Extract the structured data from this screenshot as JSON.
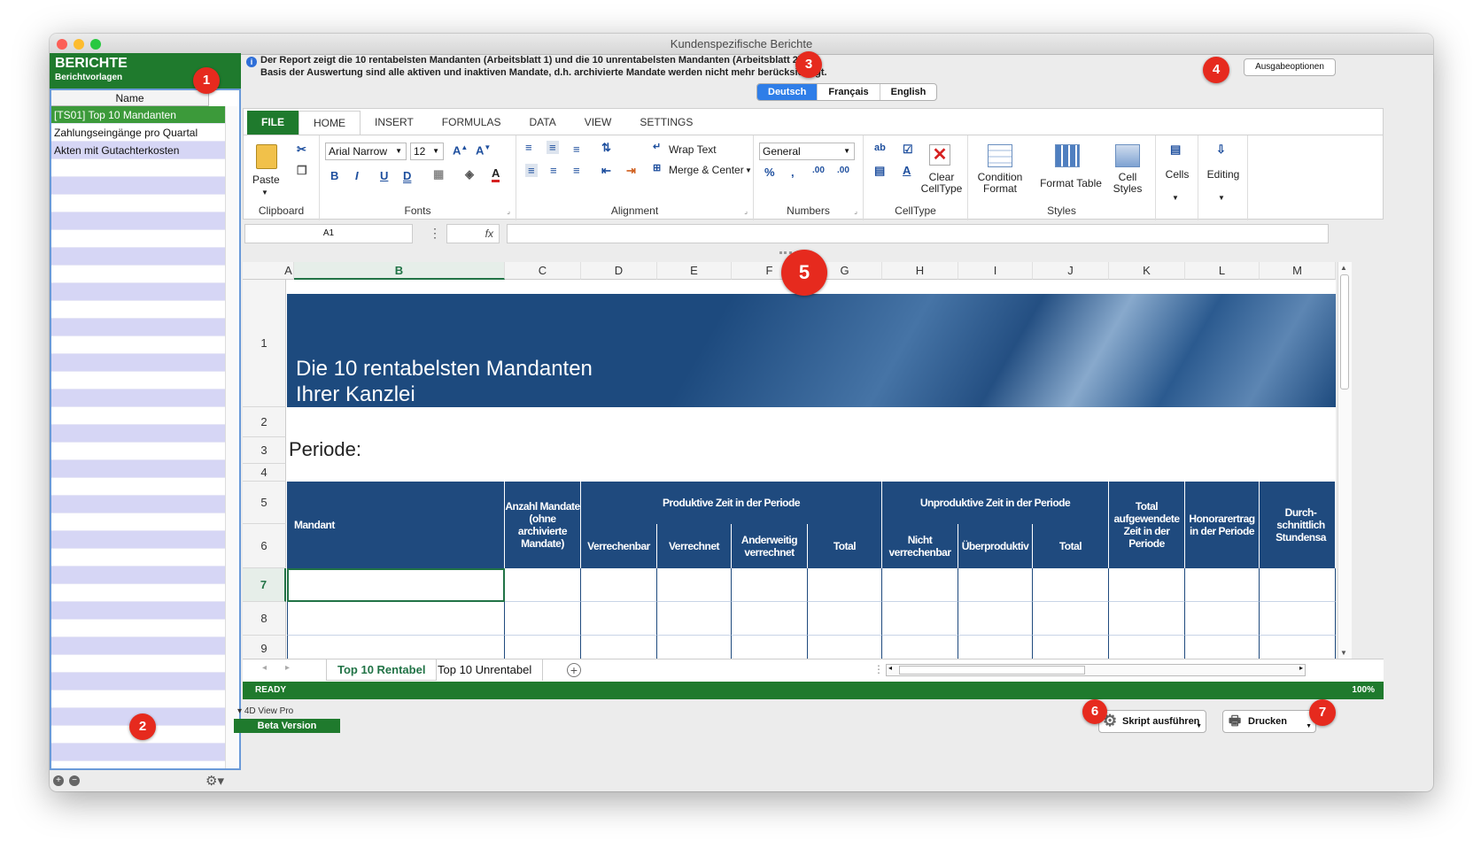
{
  "window": {
    "title": "Kundenspezifische Berichte"
  },
  "left": {
    "title": "BERICHTE",
    "subtitle": "Berichtvorlagen",
    "column": "Name",
    "items": [
      "[TS01] Top 10 Mandanten",
      "Zahlungseingänge pro Quartal",
      "Akten mit Gutachterkosten"
    ]
  },
  "badges": [
    "1",
    "2",
    "3",
    "4",
    "5",
    "6",
    "7"
  ],
  "info": {
    "icon": "i",
    "line1": "Der Report zeigt die 10 rentabelsten Mandanten (Arbeitsblatt 1) und die 10 unrentabelsten Mandanten (Arbeitsblatt 2).",
    "line2": "Basis der Auswertung sind alle aktiven und inaktiven Mandate, d.h. archivierte Mandate werden nicht mehr berücksichtigt."
  },
  "output_options": "Ausgabeoptionen",
  "languages": [
    "Deutsch",
    "Français",
    "English"
  ],
  "ribbon": {
    "tabs": [
      "FILE",
      "HOME",
      "INSERT",
      "FORMULAS",
      "DATA",
      "VIEW",
      "SETTINGS"
    ],
    "paste": "Paste",
    "font_name": "Arial Narrow",
    "font_size": "12",
    "wrap_text": "Wrap Text",
    "merge_center": "Merge & Center",
    "number_format": "General",
    "clear_celltype": [
      "Clear",
      "CellType"
    ],
    "condition_format": [
      "Condition",
      "Format"
    ],
    "format_table": "Format Table",
    "cell_styles": [
      "Cell",
      "Styles"
    ],
    "cells": "Cells",
    "editing": "Editing",
    "groups": [
      "Clipboard",
      "Fonts",
      "Alignment",
      "Numbers",
      "CellType",
      "Styles"
    ]
  },
  "formula": {
    "cell_ref": "A1",
    "fx": "fx"
  },
  "grid": {
    "columns": [
      "A",
      "B",
      "C",
      "D",
      "E",
      "F",
      "G",
      "H",
      "I",
      "J",
      "K",
      "L",
      "M"
    ],
    "rows": [
      "1",
      "2",
      "3",
      "4",
      "5",
      "6",
      "7",
      "8",
      "9"
    ],
    "banner_line1": "Die 10 rentabelsten Mandanten",
    "banner_line2": "Ihrer Kanzlei",
    "periode": "Periode:",
    "headers": {
      "mandant": "Mandant",
      "anzahl": "Anzahl Mandate (ohne archivierte Mandate)",
      "produktiv": "Produktive Zeit in der Periode",
      "verrechenbar": "Verrechenbar",
      "verrechnet": "Verrechnet",
      "anderweitig": "Anderweitig verrechnet",
      "total": "Total",
      "unproduktiv": "Unproduktive Zeit in der Periode",
      "nicht_verrechenbar": "Nicht verrechenbar",
      "ueberproduktiv": "Überproduktiv",
      "total_aufgewendet": "Total aufgewendete Zeit in der Periode",
      "honorarertrag": "Honorarertrag in der Periode",
      "durchschnittlich": "Durch- schnittlich Stundensa"
    }
  },
  "sheets": [
    "Top 10 Rentabel",
    "Top 10 Unrentabel"
  ],
  "status": {
    "left": "READY",
    "zoom": "100%"
  },
  "bottom": {
    "view_pro": "4D View Pro",
    "beta": "Beta Version",
    "run_script": "Skript ausführen",
    "print": "Drucken"
  }
}
